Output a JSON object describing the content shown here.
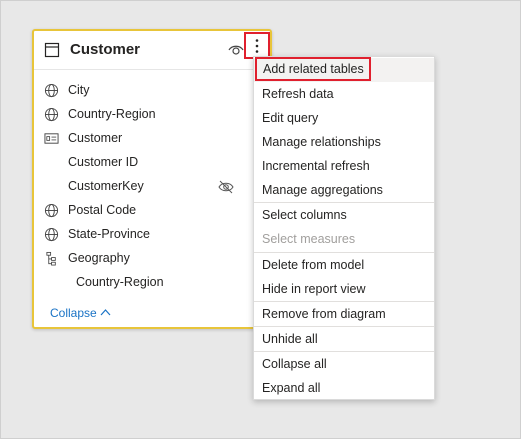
{
  "card": {
    "title": "Customer",
    "fields": [
      {
        "label": "City",
        "icon": "globe-icon"
      },
      {
        "label": "Country-Region",
        "icon": "globe-icon"
      },
      {
        "label": "Customer",
        "icon": "id-card-icon"
      },
      {
        "label": "Customer ID",
        "icon": ""
      },
      {
        "label": "CustomerKey",
        "icon": "",
        "hidden": true
      },
      {
        "label": "Postal Code",
        "icon": "globe-icon"
      },
      {
        "label": "State-Province",
        "icon": "globe-icon"
      },
      {
        "label": "Geography",
        "icon": "hierarchy-icon"
      },
      {
        "label": "Country-Region",
        "icon": ""
      }
    ],
    "collapse_label": "Collapse"
  },
  "menu": {
    "items": [
      {
        "label": "Add related tables",
        "state": "highlighted"
      },
      {
        "label": "Refresh data"
      },
      {
        "label": "Edit query"
      },
      {
        "label": "Manage relationships"
      },
      {
        "label": "Incremental refresh"
      },
      {
        "label": "Manage aggregations"
      },
      {
        "label": "Select columns"
      },
      {
        "label": "Select measures",
        "state": "disabled"
      },
      {
        "label": "Delete from model"
      },
      {
        "label": "Hide in report view"
      },
      {
        "label": "Remove from diagram"
      },
      {
        "label": "Unhide all"
      },
      {
        "label": "Collapse all"
      },
      {
        "label": "Expand all"
      }
    ]
  },
  "colors": {
    "card_border": "#e8c53a",
    "highlight_box": "#e0202e",
    "link": "#1a73c5"
  }
}
